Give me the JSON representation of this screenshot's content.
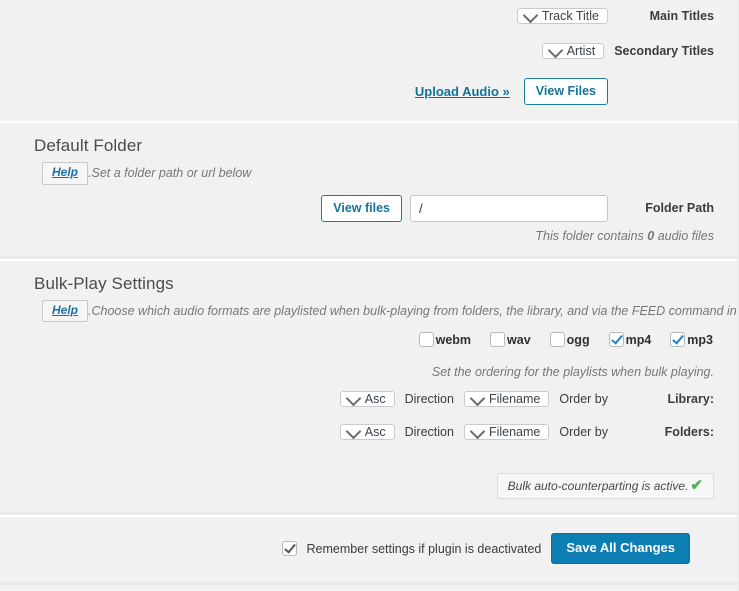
{
  "colors": {
    "background": "#f1f1f1",
    "accent_blue": "#0c7eb4",
    "link_blue": "#11719b",
    "checkbox_check": "#1d86c4",
    "success_green": "#46b450",
    "heading_gray": "#4c4c4c",
    "hint_gray": "#777777"
  },
  "titles_section": {
    "rows": [
      {
        "label": "Main Titles",
        "value": "Track Title"
      },
      {
        "label": "Secondary Titles",
        "value": "Artist"
      }
    ],
    "upload_link": "« Upload Audio",
    "view_files_button": "View Files"
  },
  "default_folder": {
    "title": "Default Folder",
    "hint": "Set a folder path or url below.",
    "help_label": "Help",
    "row_label": "Folder Path",
    "path_value": "/",
    "path_placeholder": "",
    "view_files_button": "View files",
    "folder_count_text": "This folder contains 0 audio files",
    "folder_count_prefix": "This folder contains",
    "folder_count_number": "0",
    "folder_count_suffix": "audio files"
  },
  "bulk_play": {
    "title": "Bulk-Play Settings",
    "hint": "Choose which audio formats are playlisted when bulk-playing from folders, the library, and via the FEED command in playlists.",
    "help_label": "Help",
    "formats": [
      {
        "label": "mp3",
        "checked": true
      },
      {
        "label": "mp4",
        "checked": true
      },
      {
        "label": "ogg",
        "checked": false
      },
      {
        "label": "wav",
        "checked": false
      },
      {
        "label": "webm",
        "checked": false
      }
    ],
    "ordering_hint": ".Set the ordering for the playlists when bulk playing",
    "ordering_rows": [
      {
        "scope_label": ":Library",
        "orderby_label": "Order by",
        "orderby_value": "Filename",
        "direction_label": "Direction",
        "direction_value": "Asc"
      },
      {
        "scope_label": ":Folders",
        "orderby_label": "Order by",
        "orderby_value": "Filename",
        "direction_label": "Direction",
        "direction_value": "Asc"
      }
    ],
    "counterparting_notice": ".Bulk auto-counterparting is active",
    "counterparting_tick": "✔"
  },
  "footer": {
    "remember_label": "Remember settings if plugin is deactivated",
    "remember_checked": true,
    "save_label": "Save All Changes"
  }
}
